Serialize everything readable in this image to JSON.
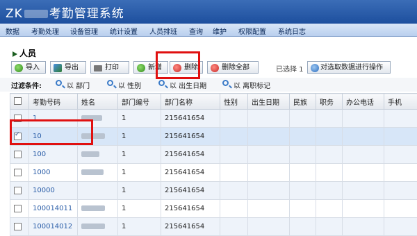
{
  "app": {
    "title_prefix": "ZK",
    "title_suffix": "考勤管理系统"
  },
  "menu": [
    "数据",
    "考勤处理",
    "设备管理",
    "统计设置",
    "人员排班",
    "查询",
    "维护",
    "权限配置",
    "系统日志"
  ],
  "section": {
    "title": "人员"
  },
  "toolbar": {
    "import_label": "导入",
    "export_label": "导出",
    "print_label": "打印",
    "add_label": "新增",
    "delete_label": "删除",
    "delete_all_label": "删除全部",
    "selected_text": "已选择 1",
    "selection_action_label": "对选取数据进行操作"
  },
  "filter": {
    "label": "过滤条件:",
    "options": [
      "以 部门",
      "以 性别",
      "以 出生日期",
      "以 离职标记"
    ]
  },
  "table": {
    "headers": [
      "考勤号码",
      "姓名",
      "部门编号",
      "部门名称",
      "性别",
      "出生日期",
      "民族",
      "职务",
      "办公电话",
      "手机"
    ],
    "rows": [
      {
        "id": "1",
        "dept_no": "1",
        "dept_name": "215641654",
        "checked": false
      },
      {
        "id": "10",
        "dept_no": "1",
        "dept_name": "215641654",
        "checked": true
      },
      {
        "id": "100",
        "dept_no": "1",
        "dept_name": "215641654",
        "checked": false
      },
      {
        "id": "1000",
        "dept_no": "1",
        "dept_name": "215641654",
        "checked": false
      },
      {
        "id": "10000",
        "dept_no": "1",
        "dept_name": "215641654",
        "checked": false
      },
      {
        "id": "100014011",
        "dept_no": "1",
        "dept_name": "215641654",
        "checked": false
      },
      {
        "id": "100014012",
        "dept_no": "1",
        "dept_name": "215641654",
        "checked": false
      }
    ]
  },
  "colors": {
    "title_bar": "#1d4f9e",
    "highlight": "#e01010",
    "link": "#2b5ea8"
  }
}
